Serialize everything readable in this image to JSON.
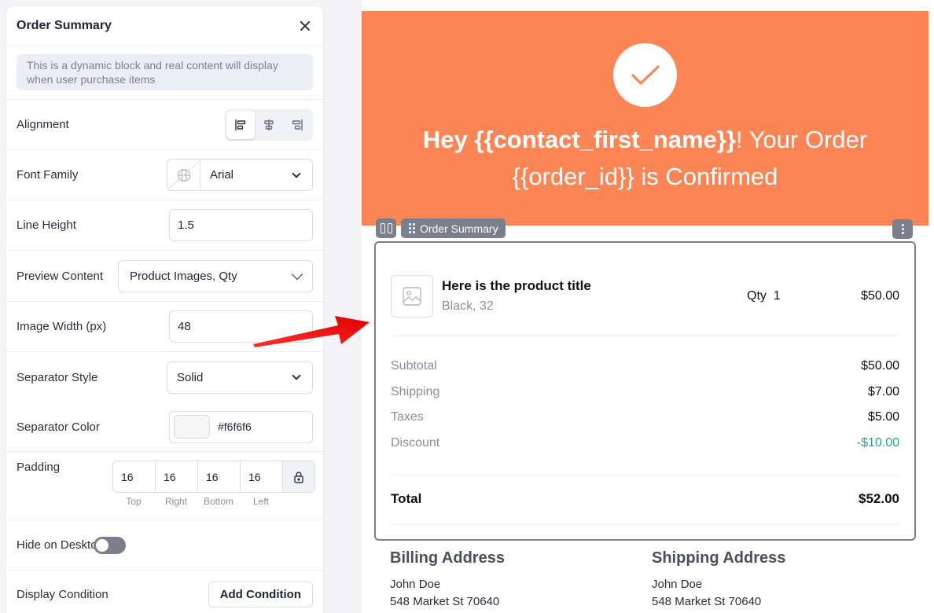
{
  "panel": {
    "title": "Order Summary",
    "notice": "This is a dynamic block and real content will display when user purchase items",
    "alignment": {
      "label": "Alignment",
      "selected": "left"
    },
    "font_family": {
      "label": "Font Family",
      "value": "Arial"
    },
    "line_height": {
      "label": "Line Height",
      "value": "1.5"
    },
    "preview_content": {
      "label": "Preview Content",
      "value": "Product Images, Qty"
    },
    "image_width": {
      "label": "Image Width (px)",
      "value": "48"
    },
    "separator_style": {
      "label": "Separator Style",
      "value": "Solid"
    },
    "separator_color": {
      "label": "Separator Color",
      "value": "#f6f6f6"
    },
    "padding": {
      "label": "Padding",
      "top": "16",
      "right": "16",
      "bottom": "16",
      "left": "16",
      "labels": {
        "top": "Top",
        "right": "Right",
        "bottom": "Bottom",
        "left": "Left"
      }
    },
    "hide_desktop": {
      "label": "Hide on Desktop",
      "on": false
    },
    "display_condition": {
      "label": "Display Condition",
      "button": "Add Condition"
    }
  },
  "email": {
    "hero_color": "#fc8555",
    "hero_bold": "Hey {{contact_first_name}}",
    "hero_rest_1": "! Your Order",
    "hero_line2": "{{order_id}} is Confirmed",
    "block_tag": "Order Summary",
    "product": {
      "title": "Here is the product title",
      "variant": "Black, 32",
      "qty_label": "Qty",
      "qty": "1",
      "price": "$50.00"
    },
    "totals": [
      {
        "label": "Subtotal",
        "value": "$50.00"
      },
      {
        "label": "Shipping",
        "value": "$7.00"
      },
      {
        "label": "Taxes",
        "value": "$5.00"
      },
      {
        "label": "Discount",
        "value": "-$10.00"
      }
    ],
    "total": {
      "label": "Total",
      "value": "$52.00"
    },
    "billing": {
      "title": "Billing Address",
      "name": "John Doe",
      "street": "548 Market St 70640"
    },
    "shipping": {
      "title": "Shipping Address",
      "name": "John Doe",
      "street": "548 Market St 70640"
    }
  }
}
